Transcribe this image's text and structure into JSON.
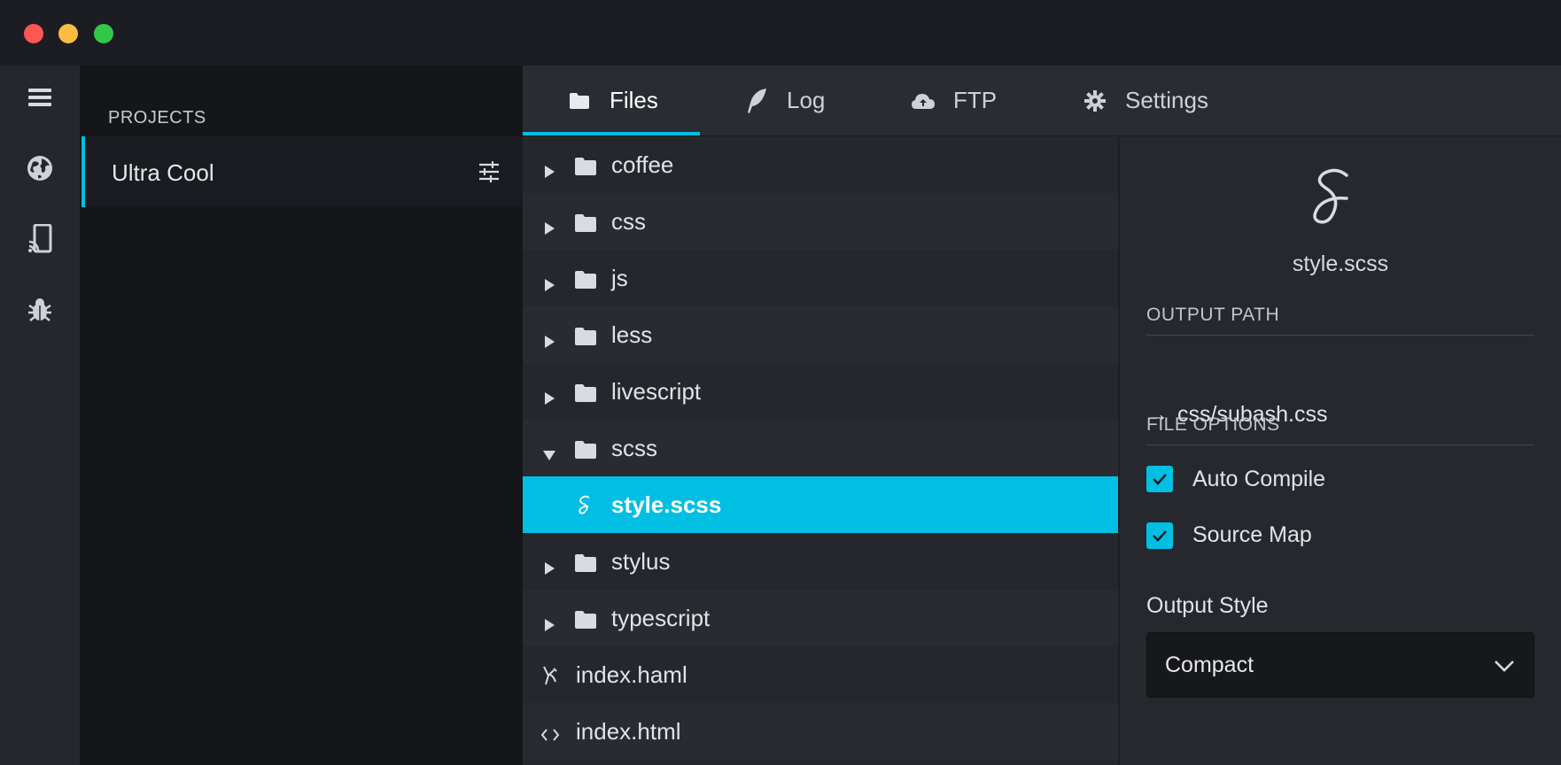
{
  "window": {
    "controls": [
      "close",
      "minimize",
      "maximize"
    ]
  },
  "rail": {
    "icons": [
      "menu-icon",
      "globe-icon",
      "device-cast-icon",
      "bug-icon"
    ]
  },
  "projects": {
    "header": "PROJECTS",
    "items": [
      {
        "name": "Ultra Cool",
        "selected": true
      }
    ]
  },
  "tabs": [
    {
      "label": "Files",
      "icon": "folder-icon",
      "active": true
    },
    {
      "label": "Log",
      "icon": "feather-icon",
      "active": false
    },
    {
      "label": "FTP",
      "icon": "cloud-upload-icon",
      "active": false
    },
    {
      "label": "Settings",
      "icon": "gear-icon",
      "active": false
    }
  ],
  "tree": {
    "rows": [
      {
        "label": "coffee",
        "type": "folder",
        "expanded": false
      },
      {
        "label": "css",
        "type": "folder",
        "expanded": false
      },
      {
        "label": "js",
        "type": "folder",
        "expanded": false
      },
      {
        "label": "less",
        "type": "folder",
        "expanded": false
      },
      {
        "label": "livescript",
        "type": "folder",
        "expanded": false
      },
      {
        "label": "scss",
        "type": "folder",
        "expanded": true
      },
      {
        "label": "style.scss",
        "type": "sass-file",
        "selected": true
      },
      {
        "label": "stylus",
        "type": "folder",
        "expanded": false
      },
      {
        "label": "typescript",
        "type": "folder",
        "expanded": false
      },
      {
        "label": "index.haml",
        "type": "haml-file"
      },
      {
        "label": "index.html",
        "type": "html-file"
      }
    ]
  },
  "details": {
    "filename": "style.scss",
    "output_path_title": "OUTPUT PATH",
    "output_path": "css/subash.css",
    "file_options_title": "FILE OPTIONS",
    "options": [
      {
        "label": "Auto Compile",
        "checked": true
      },
      {
        "label": "Source Map",
        "checked": true
      }
    ],
    "output_style_label": "Output Style",
    "output_style_value": "Compact"
  },
  "colors": {
    "accent": "#00bfe2",
    "titlebar": "#1c1d22",
    "sidebar": "#15161a",
    "panel": "#26282e"
  }
}
